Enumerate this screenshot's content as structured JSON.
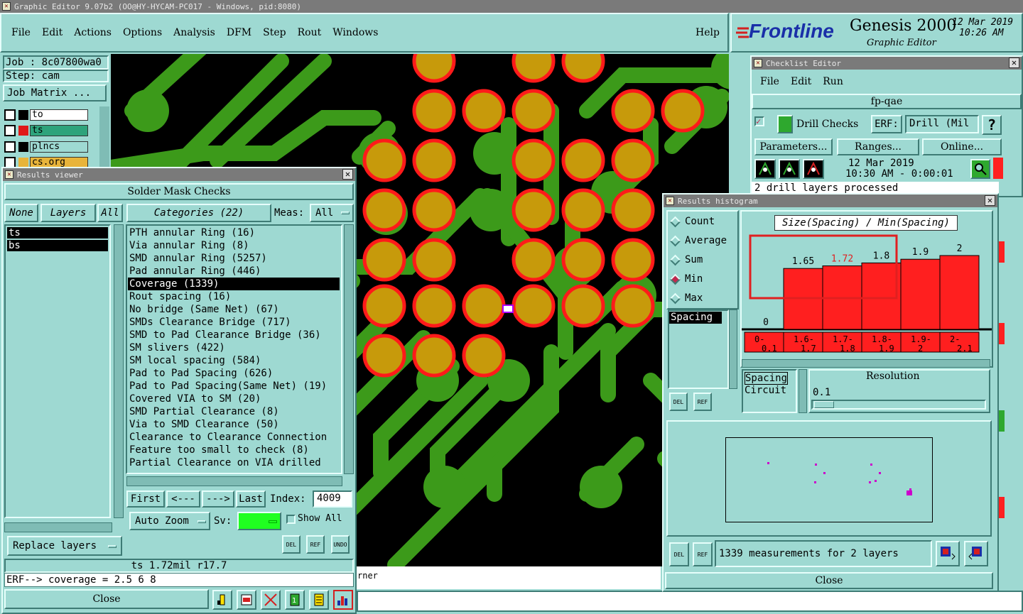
{
  "window": {
    "title": "Graphic Editor 9.07b2 (OO@HY-HYCAM-PC017 - Windows, pid:8080)"
  },
  "menu": [
    "File",
    "Edit",
    "Actions",
    "Options",
    "Analysis",
    "DFM",
    "Step",
    "Rout",
    "Windows"
  ],
  "help": "Help",
  "brand": {
    "logo": "Frontline",
    "product": "Genesis 2000",
    "sub": "Graphic Editor",
    "date": "12 Mar 2019",
    "time": "10:26 AM"
  },
  "job": {
    "job": "Job : 8c07800wa0",
    "step": "Step: cam",
    "matrix": "Job Matrix ..."
  },
  "layers": [
    {
      "name": "to",
      "color": "#000000"
    },
    {
      "name": "ts",
      "color": "#e01818"
    },
    {
      "name": "plncs",
      "color": "#000000"
    },
    {
      "name": "cs.org",
      "color": "#e8b43a"
    }
  ],
  "results_viewer": {
    "title": "Results viewer",
    "heading": "Solder Mask Checks",
    "none": "None",
    "layers_label": "Layers",
    "all": "All",
    "layer_items": [
      "ts",
      "bs"
    ],
    "categories_label": "Categories (22)",
    "meas_label": "Meas:",
    "meas_value": "All",
    "categories": [
      "PTH annular Ring (16)",
      "Via annular Ring (8)",
      "SMD annular Ring (5257)",
      "Pad annular Ring (446)",
      "Coverage (1339)",
      "Rout spacing (16)",
      "No bridge (Same Net) (67)",
      "SMDs Clearance Bridge (717)",
      "SMD to Pad Clearance Bridge (36)",
      "SM slivers (422)",
      "SM local spacing (584)",
      "Pad to Pad Spacing (626)",
      "Pad to Pad Spacing(Same Net) (19)",
      "Covered VIA to SM (20)",
      "SMD Partial Clearance (8)",
      "Via to SMD Clearance (50)",
      "Clearance to Clearance Connection",
      "Feature too small to check (8)",
      "Partial Clearance on VIA drilled"
    ],
    "selected_index": 4,
    "first": "First",
    "prev": "<---",
    "next": "--->",
    "last": "Last",
    "index_label": "Index:",
    "index_value": "4009",
    "auto_zoom": "Auto Zoom",
    "sv_label": "Sv:",
    "show_all": "Show All",
    "replace_layers": "Replace layers",
    "del": "DEL",
    "ref": "REF",
    "undo": "UNDO",
    "status": "ts 1.72mil   r17.7",
    "erf": "ERF--> coverage = 2.5 6 8",
    "close": "Close"
  },
  "canvas_text": "rner",
  "checklist": {
    "title": "Checklist Editor",
    "menu": [
      "File",
      "Edit",
      "Run"
    ],
    "name": "fp-qae",
    "drill_checks": "Drill Checks",
    "erf_label": "ERF:",
    "erf_value": "Drill (Mil",
    "help_q": "?",
    "parameters": "Parameters...",
    "ranges": "Ranges...",
    "online": "Online...",
    "date": "12 Mar 2019",
    "time": "10:30 AM - 0:00:01",
    "message": "2 drill layers processed"
  },
  "histogram": {
    "title": "Results histogram",
    "options": [
      "Count",
      "Average",
      "Sum",
      "Min",
      "Max"
    ],
    "selected_option": "Min",
    "list_item": "Spacing",
    "chart_title": "Size(Spacing) / Min(Spacing)",
    "bins": [
      "0-0.1",
      "1.6-1.7",
      "1.7-1.8",
      "1.8-1.9",
      "1.9-2",
      "2-2.1"
    ],
    "value_labels": [
      "0",
      "1.65",
      "1.72",
      "1.8",
      "1.9",
      "2"
    ],
    "highlight_bin": 2,
    "attr_list": [
      "Spacing",
      "Circuit"
    ],
    "resolution_label": "Resolution",
    "resolution_value": "0.1",
    "del": "DEL",
    "ref": "REF",
    "measurements": "1339 measurements for 2 layers",
    "close": "Close"
  },
  "chart_data": {
    "type": "bar",
    "title": "Size(Spacing) / Min(Spacing)",
    "categories": [
      "0-0.1",
      "1.6-1.7",
      "1.7-1.8",
      "1.8-1.9",
      "1.9-2",
      "2-2.1"
    ],
    "values": [
      0,
      1.65,
      1.72,
      1.8,
      1.9,
      2
    ],
    "ylim": [
      0,
      2
    ],
    "grid": false
  },
  "colors": {
    "teal": "#9ed9d2",
    "pcb_bg": "#000000",
    "trace": "#3c9a1a",
    "pad": "#c79a0b",
    "pad_ring": "#ff1a1a",
    "bar": "#ff1f1f",
    "highlight_box": "#e02020"
  }
}
